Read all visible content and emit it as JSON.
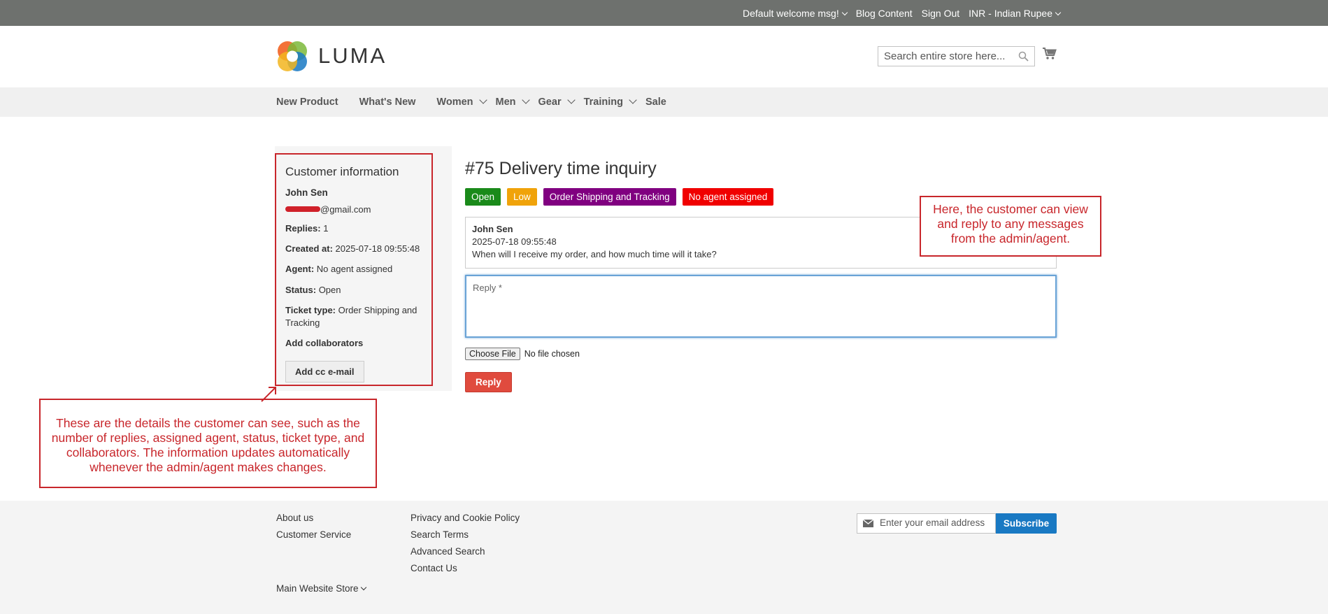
{
  "top_bar": {
    "welcome": "Default welcome msg!",
    "blog": "Blog Content",
    "sign_out": "Sign Out",
    "currency": "INR - Indian Rupee"
  },
  "header": {
    "logo_text": "LUMA",
    "search_placeholder": "Search entire store here..."
  },
  "nav": {
    "items": [
      {
        "label": "New Product"
      },
      {
        "label": "What's New"
      },
      {
        "label": "Women"
      },
      {
        "label": "Men"
      },
      {
        "label": "Gear"
      },
      {
        "label": "Training"
      },
      {
        "label": "Sale"
      }
    ]
  },
  "sidebar": {
    "title": "Customer information",
    "name": "John Sen",
    "email_suffix": "@gmail.com",
    "replies_label": "Replies:",
    "replies_value": "1",
    "created_label": "Created at:",
    "created_value": "2025-07-18 09:55:48",
    "agent_label": "Agent:",
    "agent_value": "No agent assigned",
    "status_label": "Status:",
    "status_value": "Open",
    "type_label": "Ticket type:",
    "type_value": "Order Shipping and Tracking",
    "collab_label": "Add collaborators",
    "cc_button": "Add cc e-mail"
  },
  "ticket": {
    "title": "#75 Delivery time inquiry",
    "badges": [
      {
        "label": "Open",
        "color": "#1a8a1a"
      },
      {
        "label": "Low",
        "color": "#f0a30a"
      },
      {
        "label": "Order Shipping and Tracking",
        "color": "#800080"
      },
      {
        "label": "No agent assigned",
        "color": "#f00000"
      }
    ],
    "message": {
      "author": "John Sen",
      "time": "2025-07-18 09:55:48",
      "text": "When will I receive my order, and how much time will it take?"
    },
    "reply_placeholder": "Reply *",
    "choose_file": "Choose File",
    "no_file": "No file chosen",
    "reply_button": "Reply"
  },
  "annotations": {
    "right": "Here, the customer can view and reply to any messages from the admin/agent.",
    "left": "These are the details the customer can see, such as the number of replies, assigned agent, status, ticket type, and collaborators. The information updates automatically whenever the admin/agent makes changes."
  },
  "footer": {
    "col1": [
      "About us",
      "Customer Service"
    ],
    "col2": [
      "Privacy and Cookie Policy",
      "Search Terms",
      "Advanced Search",
      "Contact Us"
    ],
    "store": "Main Website Store",
    "newsletter_placeholder": "Enter your email address",
    "subscribe": "Subscribe"
  },
  "colors": {
    "accent_red": "#c8262b",
    "subscribe_blue": "#1979c3"
  }
}
